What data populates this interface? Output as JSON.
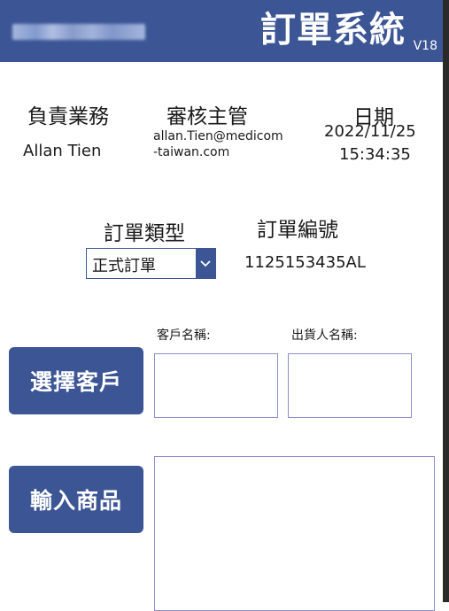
{
  "header": {
    "title": "訂單系統",
    "version": "V18"
  },
  "info": {
    "sales_label": "負責業務",
    "sales_name": "Allan Tien",
    "supervisor_label": "審核主管",
    "supervisor_email": "allan.Tien@medicom-taiwan.com",
    "date_label": "日期",
    "date_value": "2022/11/25",
    "time_value": "15:34:35"
  },
  "order": {
    "type_label": "訂單類型",
    "type_selected": "正式訂單",
    "number_label": "訂單編號",
    "number_value": "1125153435AL"
  },
  "customer": {
    "customer_name_label": "客戶名稱:",
    "shipper_name_label": "出貨人名稱:",
    "select_button": "選擇客戶",
    "input_products_button": "輸入商品"
  },
  "colors": {
    "brand": "#3c5595",
    "box_border": "#8e8ec7"
  }
}
